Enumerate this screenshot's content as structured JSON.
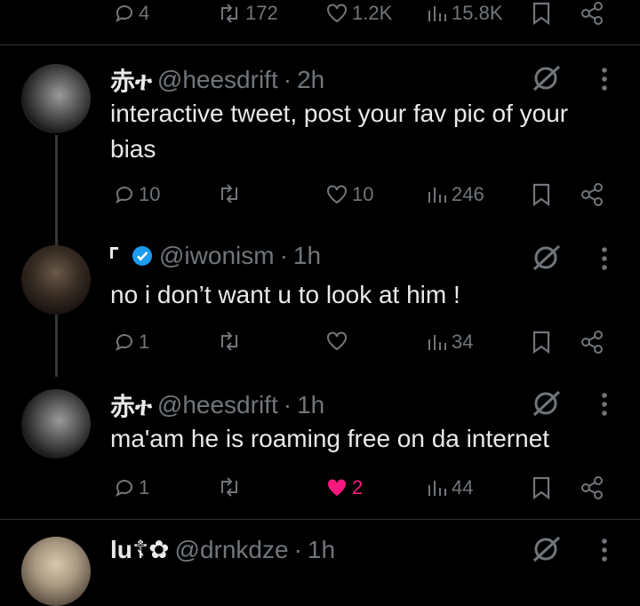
{
  "top_actions": {
    "replies": "4",
    "reposts": "172",
    "likes": "1.2K",
    "views": "15.8K"
  },
  "tweets": [
    {
      "name": "赤ተ",
      "handle": "@heesdrift",
      "sep": "·",
      "time": "2h",
      "text": "interactive tweet, post your fav pic of your bias",
      "replies": "10",
      "reposts": "",
      "likes": "10",
      "views": "246"
    },
    {
      "name": "",
      "handle": "@iwonism",
      "sep": "·",
      "time": "1h",
      "text": "no i don’t want u to look at him !",
      "replies": "1",
      "reposts": "",
      "likes": "",
      "views": "34"
    },
    {
      "name": "赤ተ",
      "handle": "@heesdrift",
      "sep": "·",
      "time": "1h",
      "text": "ma'am he is roaming free on da internet",
      "replies": "1",
      "reposts": "",
      "likes": "2",
      "views": "44"
    },
    {
      "name": "lu☦✿",
      "handle": "@drnkdze",
      "sep": "·",
      "time": "1h",
      "text": "",
      "replies": "",
      "reposts": "",
      "likes": "",
      "views": ""
    }
  ],
  "colors": {
    "accent": "#1d9bf0",
    "like": "#f91880",
    "muted": "#71767b",
    "text": "#e7e9ea"
  }
}
